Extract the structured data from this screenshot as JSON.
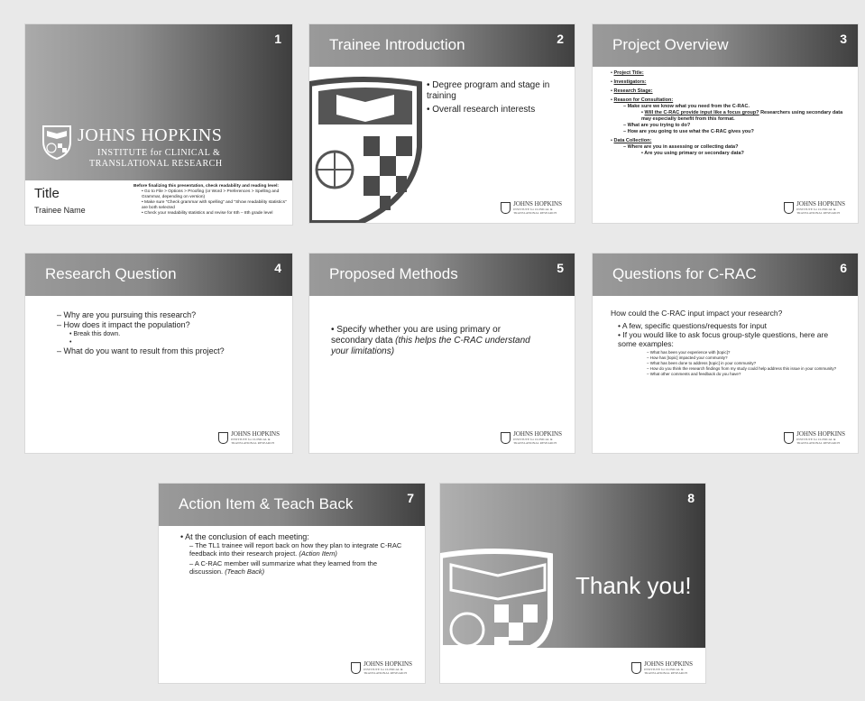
{
  "slide1": {
    "number": "1",
    "logo_line1": "JOHNS HOPKINS",
    "logo_line2": "INSTITUTE for CLINICAL &",
    "logo_line3": "TRANSLATIONAL RESEARCH",
    "title": "Title",
    "subtitle": "Trainee Name",
    "note_heading": "Before finalizing this presentation, check readability and reading level:",
    "note_items": [
      "Go to File > Options > Proofing (or Word > Preferences > Spelling and Grammar, depending on version)",
      "Make sure \"Check grammar with spelling\" and \"Show readability statistics\" are both selected",
      "Check your readability statistics and revise for 6th – 8th grade level"
    ]
  },
  "slide2": {
    "number": "2",
    "title": "Trainee Introduction",
    "bullets": [
      "Degree program and stage in training",
      "Overall research interests"
    ]
  },
  "slide3": {
    "number": "3",
    "title": "Project Overview",
    "items": {
      "project_title": "Project Title:",
      "investigators": "Investigators:",
      "research_stage": "Research Stage:",
      "reason": "Reason for Consultation:",
      "reason_sub1": "Make sure we know what you need from the C-RAC.",
      "reason_sub1a_u": "Will the C-RAC provide input like a focus group?",
      "reason_sub1a_rest": " Researchers using secondary data may especially benefit from this format.",
      "reason_sub2": "What are you trying to do?",
      "reason_sub3": "How are you going to use what the C-RAC gives you?",
      "data_collection": "Data Collection:",
      "data_sub1": "Where are you in assessing or collecting data?",
      "data_sub1a": "Are you using primary or secondary data?"
    }
  },
  "slide4": {
    "number": "4",
    "title": "Research Question",
    "q1": "Why are you pursuing this research?",
    "q2": "How does it impact the population?",
    "q2a": "Break this down.",
    "q2b": "",
    "q3": "What do you want to result from this project?"
  },
  "slide5": {
    "number": "5",
    "title": "Proposed Methods",
    "text": "Specify whether you are using primary or secondary data ",
    "text_italic": "(this helps the C-RAC understand your limitations)"
  },
  "slide6": {
    "number": "6",
    "title": "Questions for C-RAC",
    "intro": "How could the C-RAC input impact your research?",
    "b1": "A few, specific questions/requests for input",
    "b2": "If you would like to ask focus group-style questions, here are some examples:",
    "examples": [
      "What has been your experience with [topic]?",
      "How has [topic] impacted your community?",
      "What has been done to address [topic] in your community?",
      "How do you think the research findings from my study could help address this issue in your community?",
      "What other comments and feedback do you have?"
    ]
  },
  "slide7": {
    "number": "7",
    "title": "Action Item & Teach Back",
    "b1": "At the conclusion of each meeting:",
    "s1": "The TL1 trainee will report back on how they plan to integrate C-RAC feedback into their research project. ",
    "s1_italic": "(Action Item)",
    "s2": "A C-RAC member will summarize what they learned from the discussion. ",
    "s2_italic": "(Teach Back)"
  },
  "slide8": {
    "number": "8",
    "text": "Thank you!"
  },
  "footer_logo": {
    "name": "JOHNS HOPKINS",
    "sub1": "INSTITUTE for CLINICAL &",
    "sub2": "TRANSLATIONAL RESEARCH"
  }
}
